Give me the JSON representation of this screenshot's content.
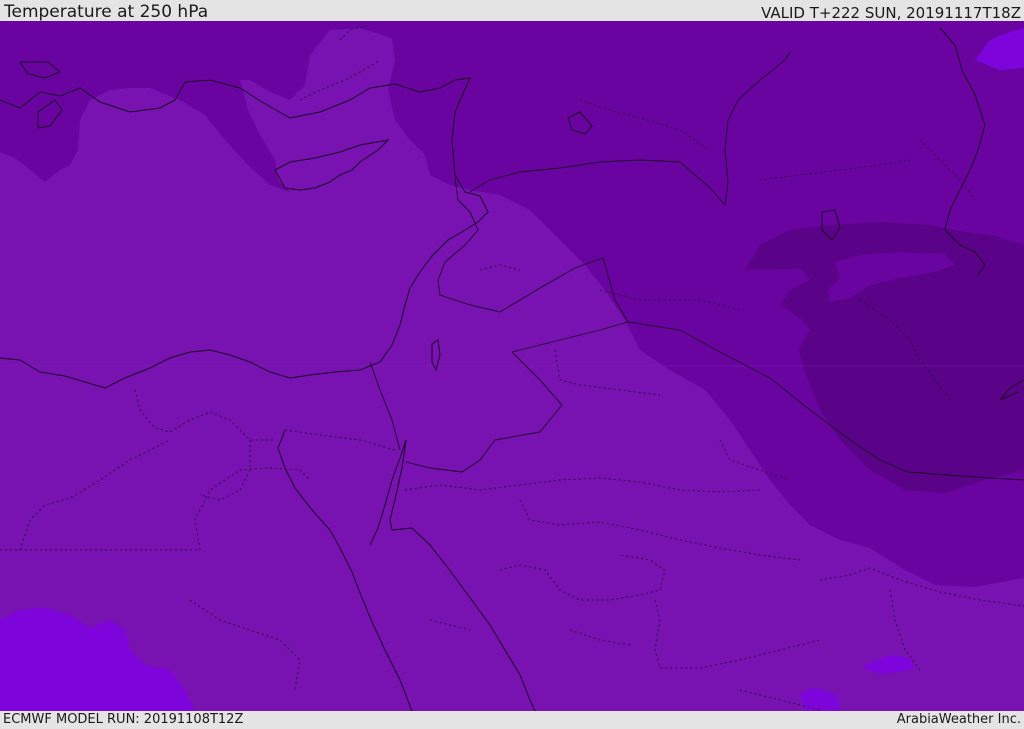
{
  "header": {
    "title": "Temperature at 250 hPa",
    "valid": "VALID T+222 SUN, 20191117T18Z"
  },
  "footer": {
    "model_run": "ECMWF MODEL RUN: 20191108T12Z",
    "credit": "ArabiaWeather Inc."
  },
  "map": {
    "field": "temperature-250hPa",
    "colors": {
      "base": "#7812b0",
      "cold": "#6a04a0",
      "coldest": "#5a0388",
      "warm": "#7e04dc",
      "coastline": "#1c0028",
      "border": "#1c0028"
    }
  }
}
